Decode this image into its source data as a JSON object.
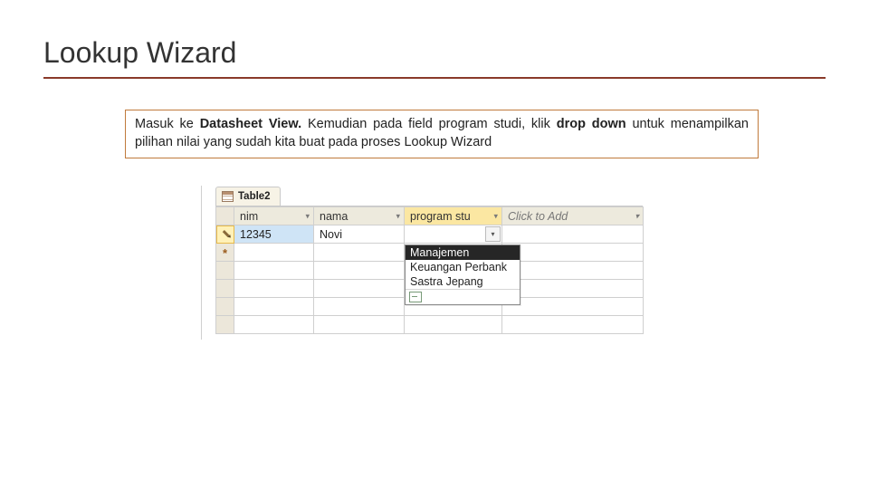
{
  "slide": {
    "title": "Lookup Wizard",
    "callout_pre": "Masuk ke ",
    "callout_b1": "Datasheet View.",
    "callout_mid": " Kemudian pada field program studi, klik ",
    "callout_b2": "drop down",
    "callout_post": " untuk menampilkan pilihan nilai yang sudah kita buat pada proses Lookup Wizard"
  },
  "screenshot": {
    "tab_label": "Table2",
    "columns": {
      "nim": "nim",
      "nama": "nama",
      "prog": "program stu",
      "add": "Click to Add"
    },
    "row1": {
      "nim": "12345",
      "nama": "Novi"
    },
    "dropdown": {
      "options": [
        "Manajemen",
        "Keuangan Perbank",
        "Sastra Jepang"
      ],
      "highlighted_index": 0
    }
  }
}
